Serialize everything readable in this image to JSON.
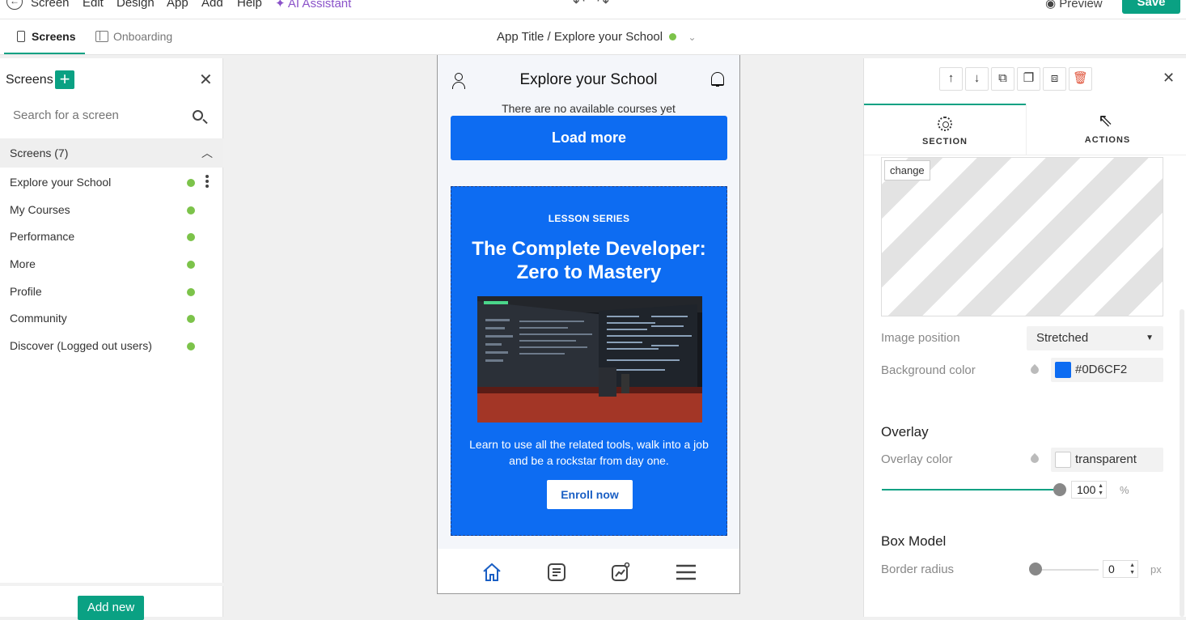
{
  "menubar": {
    "items": [
      "Screen",
      "Edit",
      "Design",
      "App",
      "Add",
      "Help"
    ],
    "ai_label": "AI Assistant",
    "preview_label": "Preview",
    "save_label": "Save"
  },
  "tabs": {
    "screens_label": "Screens",
    "onboarding_label": "Onboarding",
    "app_title": "App Title / Explore your School"
  },
  "left": {
    "title": "Screens",
    "search_placeholder": "Search for a screen",
    "group_label": "Screens (7)",
    "screens": [
      {
        "name": "Explore your School"
      },
      {
        "name": "My Courses"
      },
      {
        "name": "Performance"
      },
      {
        "name": "More"
      },
      {
        "name": "Profile"
      },
      {
        "name": "Community"
      },
      {
        "name": "Discover (Logged out users)"
      }
    ],
    "add_new_label": "Add new"
  },
  "phone": {
    "title": "Explore your School",
    "empty_text": "There are no available courses yet",
    "load_more": "Load more",
    "card": {
      "kicker": "LESSON SERIES",
      "title": "The Complete Developer: Zero to Mastery",
      "description": "Learn to use all the related tools, walk into a job and be a rockstar from day one.",
      "cta": "Enroll now"
    },
    "accent": "#0D6CF2"
  },
  "right": {
    "tab_section": "SECTION",
    "tab_actions": "ACTIONS",
    "change_label": "change",
    "image_position_label": "Image position",
    "image_position_value": "Stretched",
    "bg_color_label": "Background color",
    "bg_color_value": "#0D6CF2",
    "overlay_heading": "Overlay",
    "overlay_color_label": "Overlay color",
    "overlay_color_value": "transparent",
    "overlay_opacity": "100",
    "overlay_unit": "%",
    "box_model_heading": "Box Model",
    "border_radius_label": "Border radius",
    "border_radius_value": "0",
    "border_radius_unit": "px"
  },
  "colors": {
    "brand_green": "#0aa183",
    "status_green": "#7cc34a"
  }
}
